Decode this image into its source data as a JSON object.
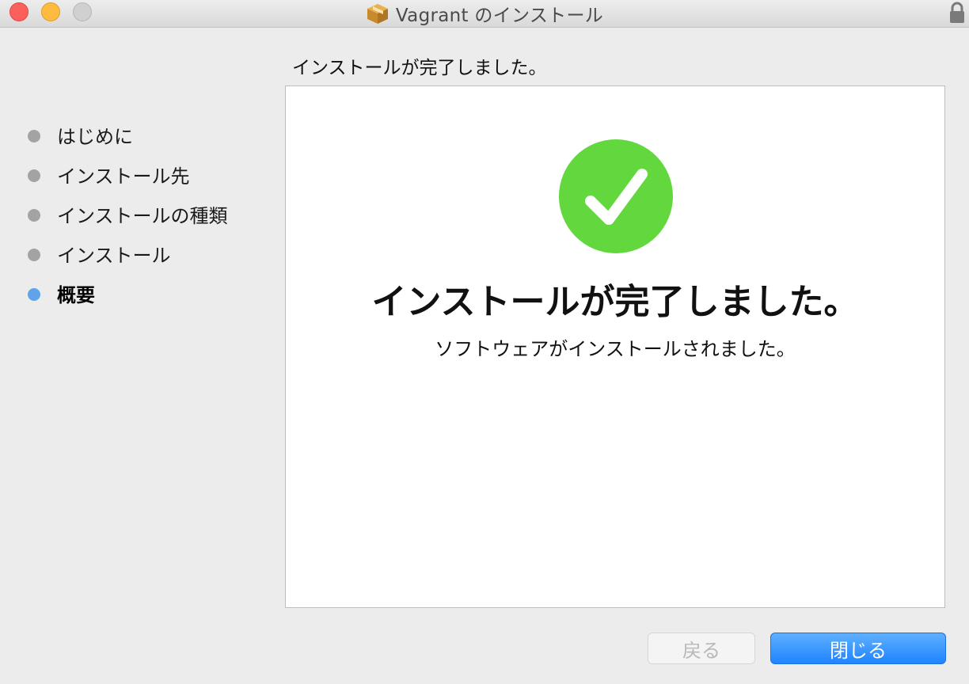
{
  "window": {
    "title": "Vagrant のインストール",
    "icon": "package-icon",
    "lock_icon": "lock-icon"
  },
  "sidebar": {
    "items": [
      {
        "label": "はじめに",
        "active": false
      },
      {
        "label": "インストール先",
        "active": false
      },
      {
        "label": "インストールの種類",
        "active": false
      },
      {
        "label": "インストール",
        "active": false
      },
      {
        "label": "概要",
        "active": true
      }
    ]
  },
  "main": {
    "header": "インストールが完了しました。",
    "status_icon": "checkmark-icon",
    "headline": "インストールが完了しました。",
    "message": "ソフトウェアがインストールされました。"
  },
  "buttons": {
    "back_label": "戻る",
    "close_label": "閉じる"
  },
  "colors": {
    "success_green": "#62d83e",
    "accent_blue": "#1f84ff",
    "active_step_dot": "#5ea4ea"
  }
}
